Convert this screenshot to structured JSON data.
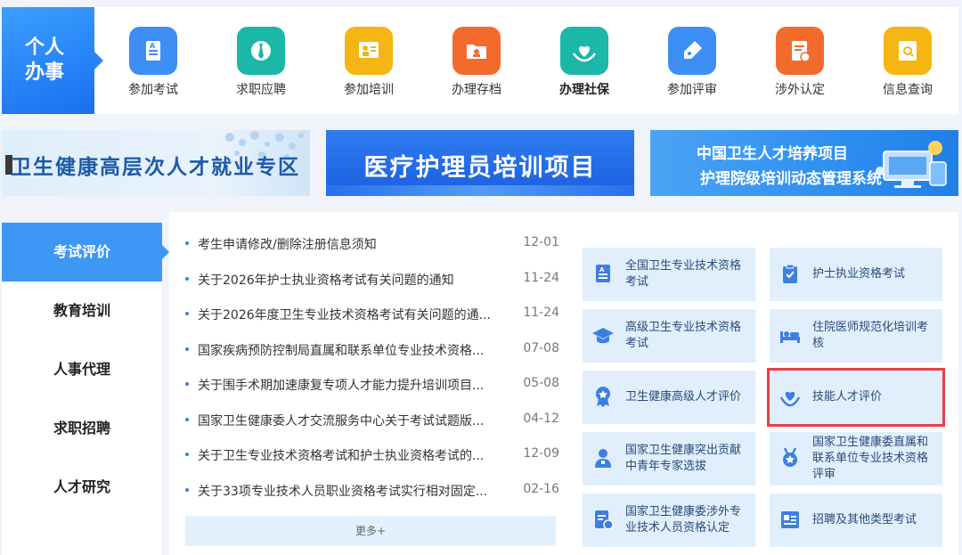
{
  "personal": {
    "line1": "个人",
    "line2": "办事"
  },
  "services": [
    {
      "label": "参加考试",
      "icon": "exam-icon",
      "color": "#3d8ef5",
      "bold": false
    },
    {
      "label": "求职应聘",
      "icon": "tie-icon",
      "color": "#1bb7a9",
      "bold": false
    },
    {
      "label": "参加培训",
      "icon": "training-icon",
      "color": "#f5b512",
      "bold": false
    },
    {
      "label": "办理存档",
      "icon": "folder-icon",
      "color": "#f26b2c",
      "bold": false
    },
    {
      "label": "办理社保",
      "icon": "heart-hands-icon",
      "color": "#1bb7a9",
      "bold": true
    },
    {
      "label": "参加评审",
      "icon": "pen-icon",
      "color": "#3d8ef5",
      "bold": false
    },
    {
      "label": "涉外认定",
      "icon": "certificate-icon",
      "color": "#f26b2c",
      "bold": false
    },
    {
      "label": "信息查询",
      "icon": "search-doc-icon",
      "color": "#f5b512",
      "bold": false
    }
  ],
  "banners": {
    "b1": "卫生健康高层次人才就业专区",
    "b2": "医疗护理员培训项目",
    "b3_line1": "中国卫生人才培养项目",
    "b3_line2": "护理院级培训动态管理系统"
  },
  "nav": [
    "考试评价",
    "教育培训",
    "人事代理",
    "求职招聘",
    "人才研究"
  ],
  "news": [
    {
      "title": "考生申请修改/删除注册信息须知",
      "date": "12-01"
    },
    {
      "title": "关于2026年护士执业资格考试有关问题的通知",
      "date": "11-24"
    },
    {
      "title": "关于2026年度卫生专业技术资格考试有关问题的通...",
      "date": "11-24"
    },
    {
      "title": "国家疾病预防控制局直属和联系单位专业技术资格...",
      "date": "07-08"
    },
    {
      "title": "关于围手术期加速康复专项人才能力提升培训项目...",
      "date": "05-08"
    },
    {
      "title": "国家卫生健康委人才交流服务中心关于考试试题版...",
      "date": "04-12"
    },
    {
      "title": "关于卫生专业技术资格考试和护士执业资格考试的...",
      "date": "12-09"
    },
    {
      "title": "关于33项专业技术人员职业资格考试实行相对固定...",
      "date": "02-16"
    }
  ],
  "more": "更多+",
  "tiles": [
    {
      "text": "全国卫生专业技术资格考试",
      "icon": "exam-doc-icon",
      "highlight": false
    },
    {
      "text": "护士执业资格考试",
      "icon": "clipboard-icon",
      "highlight": false
    },
    {
      "text": "高级卫生专业技术资格考试",
      "icon": "graduation-cap-icon",
      "highlight": false
    },
    {
      "text": "住院医师规范化培训考核",
      "icon": "hospital-bed-icon",
      "highlight": false
    },
    {
      "text": "卫生健康高级人才评价",
      "icon": "medal-icon",
      "highlight": false
    },
    {
      "text": "技能人才评价",
      "icon": "heart-hands-icon",
      "highlight": true
    },
    {
      "text": "国家卫生健康突出贡献中青年专家选拔",
      "icon": "doctor-icon",
      "highlight": false
    },
    {
      "text": "国家卫生健康委直属和联系单位专业技术资格评审",
      "icon": "badge-icon",
      "highlight": false
    },
    {
      "text": "国家卫生健康委涉外专业技术人员资格认定",
      "icon": "cert-stamp-icon",
      "highlight": false
    },
    {
      "text": "招聘及其他类型考试",
      "icon": "id-card-icon",
      "highlight": false
    }
  ]
}
